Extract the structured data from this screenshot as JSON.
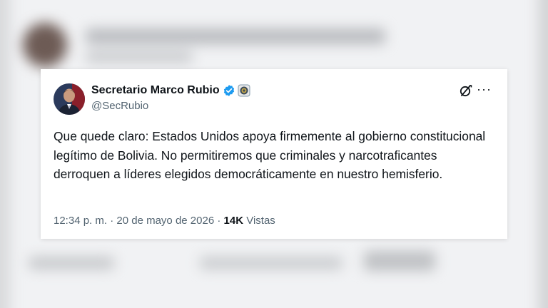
{
  "tweet": {
    "display_name": "Secretario Marco Rubio",
    "handle": "@SecRubio",
    "text": "Que quede claro: Estados Unidos apoya firmemente al gobierno constitucional legítimo de Bolivia. No permitiremos que criminales y narcotraficantes derroquen a líderes elegidos democráticamente en nuestro hemisferio.",
    "time": "12:34 p. m.",
    "separator": "·",
    "date": "20 de mayo de 2026",
    "views_count": "14K",
    "views_label": "Vistas",
    "more_label": "···"
  },
  "colors": {
    "verified": "#1d9bf0",
    "text_primary": "#0f1419",
    "text_secondary": "#536471"
  },
  "icons": [
    "verified-badge-icon",
    "government-seal-icon",
    "grok-icon",
    "more-icon"
  ]
}
